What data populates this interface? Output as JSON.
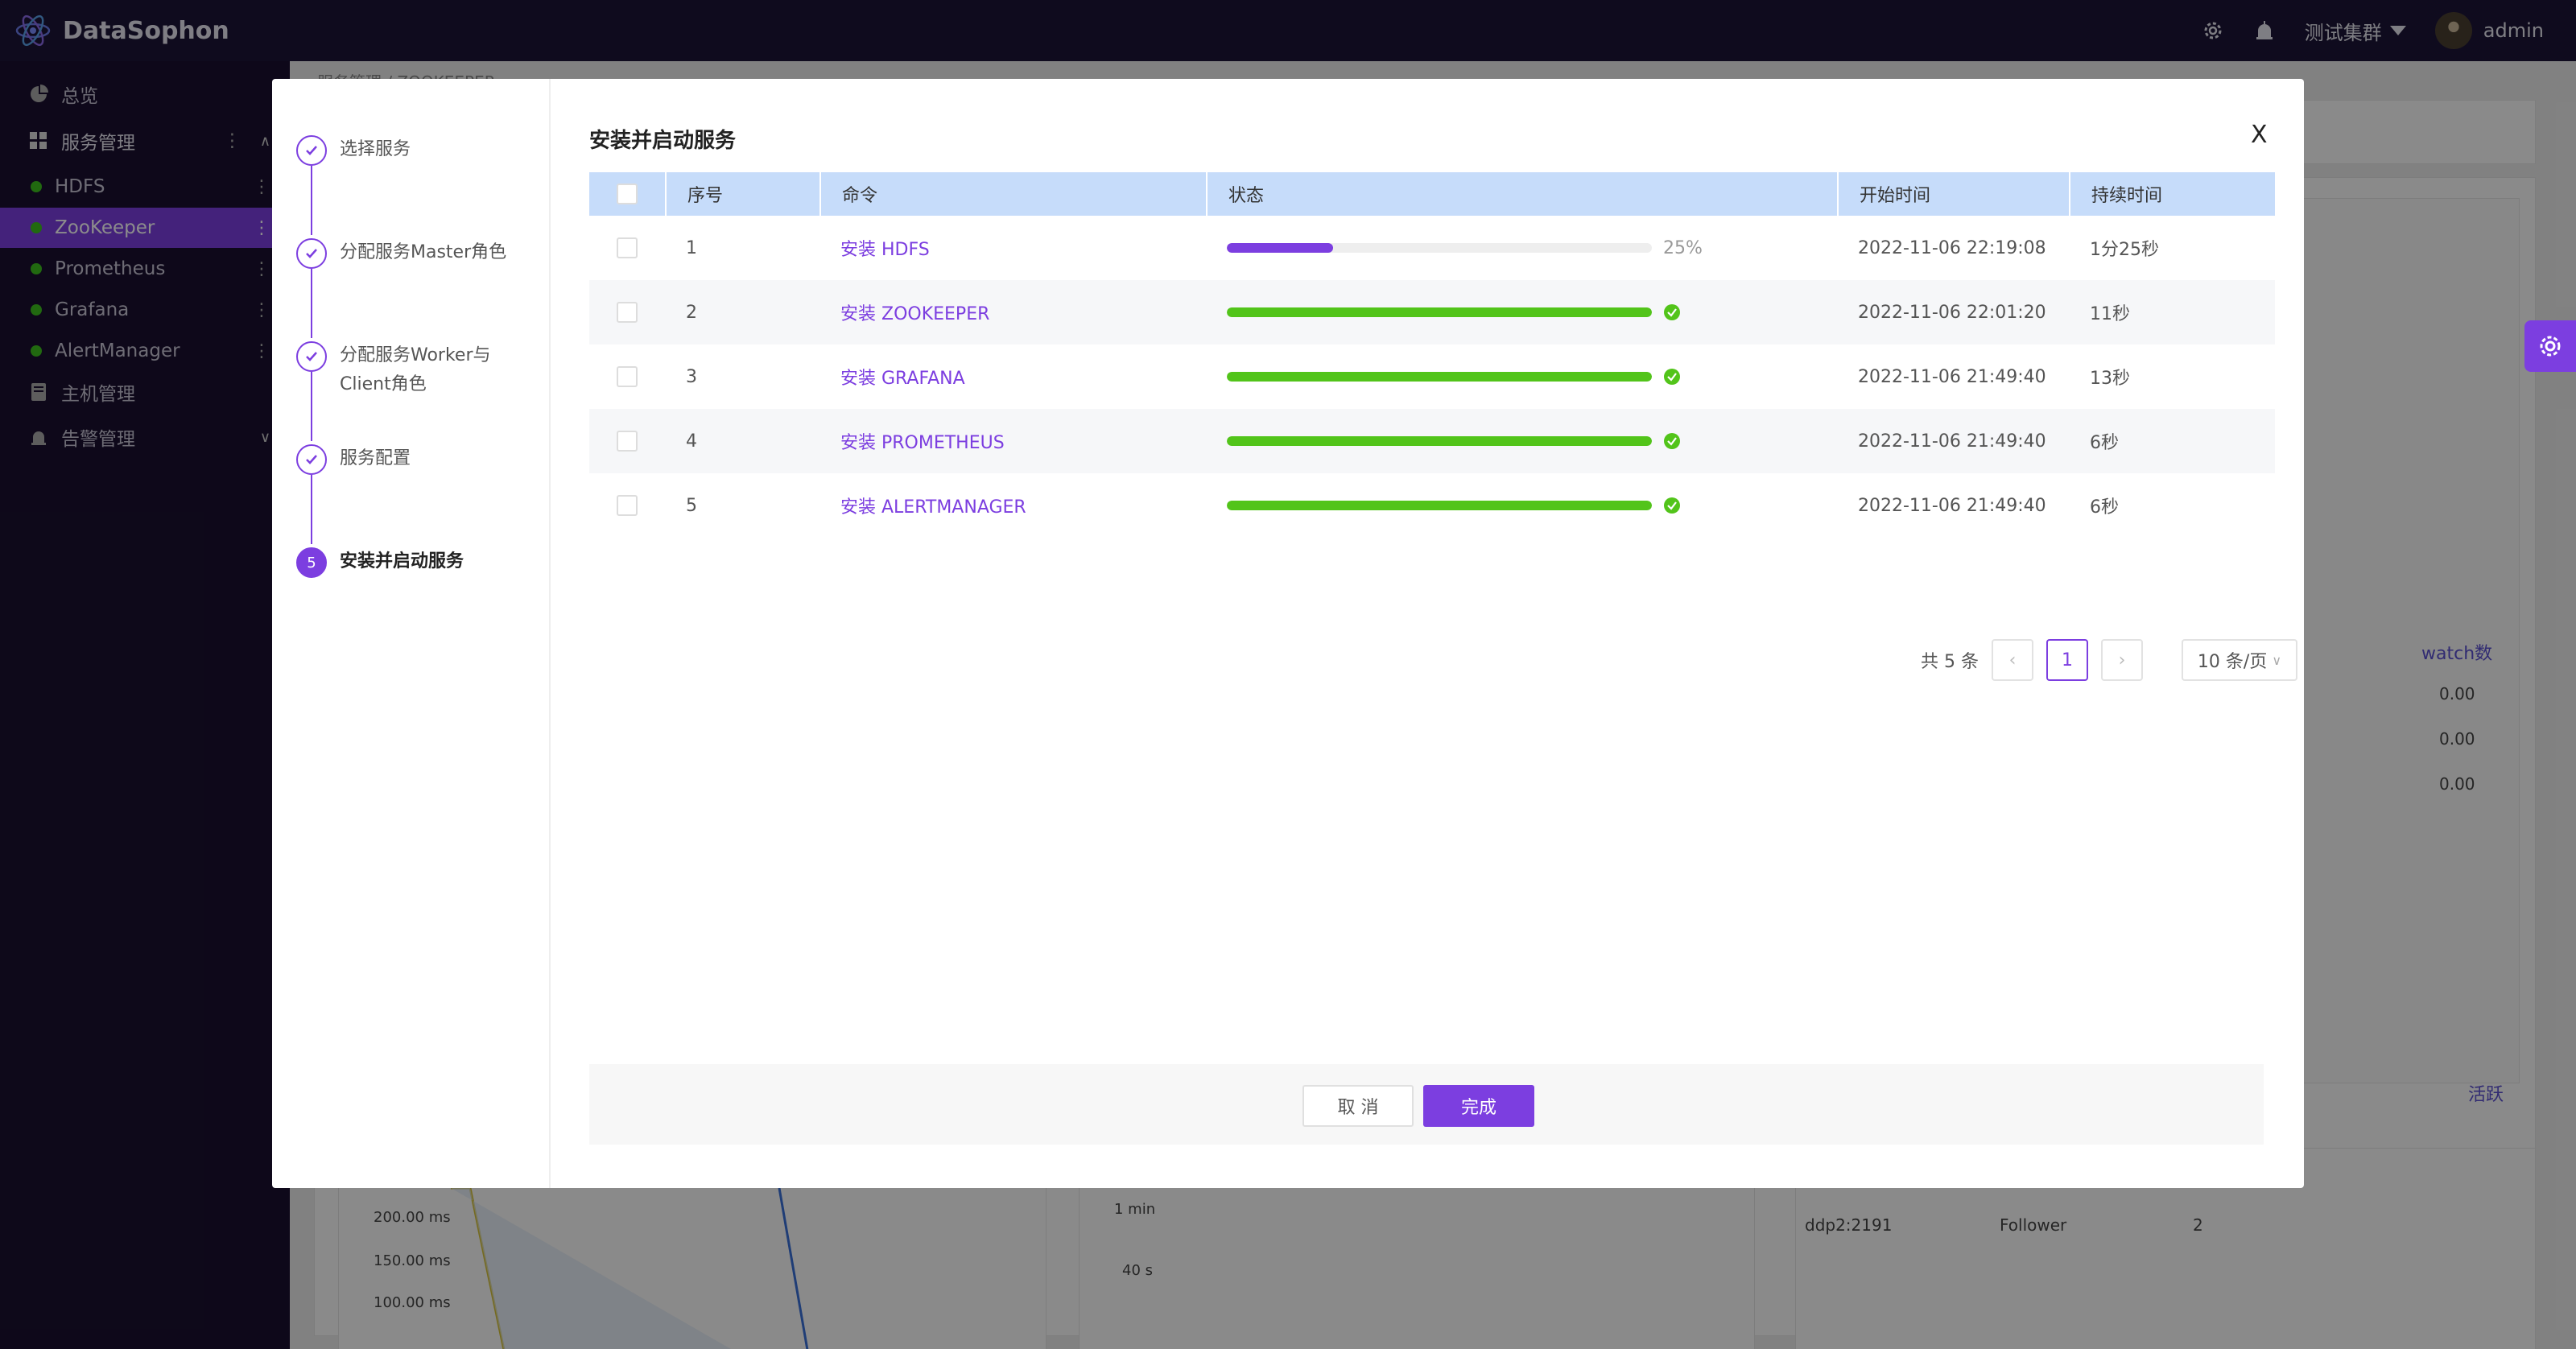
{
  "app": {
    "logo_text": "DataSophon",
    "cluster_name": "测试集群",
    "user_name": "admin"
  },
  "sidebar": {
    "items": [
      {
        "label": "总览"
      },
      {
        "label": "服务管理"
      },
      {
        "label": "HDFS"
      },
      {
        "label": "ZooKeeper"
      },
      {
        "label": "Prometheus"
      },
      {
        "label": "Grafana"
      },
      {
        "label": "AlertManager"
      },
      {
        "label": "主机管理"
      },
      {
        "label": "告警管理"
      }
    ]
  },
  "background": {
    "breadcrumb": "服务管理 / ZOOKEEPER",
    "watch_label": "watch数",
    "watch_values": [
      "0.00",
      "0.00",
      "0.00"
    ],
    "active_label": "活跃",
    "chart_ticks_left": [
      "200.00 ms",
      "150.00 ms",
      "100.00 ms"
    ],
    "chart_ticks_mid": [
      "1 min",
      "40 s"
    ],
    "host_row": {
      "host": "ddp2:2191",
      "role": "Follower",
      "value": "2"
    }
  },
  "wizard": {
    "steps": [
      {
        "label": "选择服务"
      },
      {
        "label": "分配服务Master角色"
      },
      {
        "label": "分配服务Worker与Client角色"
      },
      {
        "label": "服务配置"
      },
      {
        "label": "安装并启动服务",
        "number": "5"
      }
    ]
  },
  "modal": {
    "title": "安装并启动服务",
    "close_label": "X"
  },
  "table": {
    "columns": {
      "index": "序号",
      "command": "命令",
      "status": "状态",
      "start_time": "开始时间",
      "duration": "持续时间"
    },
    "rows": [
      {
        "index": "1",
        "command": "安装 HDFS",
        "progress": 25,
        "progress_label": "25%",
        "start_time": "2022-11-06 22:19:08",
        "duration": "1分25秒"
      },
      {
        "index": "2",
        "command": "安装 ZOOKEEPER",
        "progress": 100,
        "start_time": "2022-11-06 22:01:20",
        "duration": "11秒"
      },
      {
        "index": "3",
        "command": "安装 GRAFANA",
        "progress": 100,
        "start_time": "2022-11-06 21:49:40",
        "duration": "13秒"
      },
      {
        "index": "4",
        "command": "安装 PROMETHEUS",
        "progress": 100,
        "start_time": "2022-11-06 21:49:40",
        "duration": "6秒"
      },
      {
        "index": "5",
        "command": "安装 ALERTMANAGER",
        "progress": 100,
        "start_time": "2022-11-06 21:49:40",
        "duration": "6秒"
      }
    ]
  },
  "pagination": {
    "total": "共 5 条",
    "current_page": "1",
    "page_size": "10 条/页"
  },
  "footer": {
    "cancel_label": "取 消",
    "done_label": "完成"
  },
  "colors": {
    "accent": "#7c3ee0",
    "success": "#52c41a",
    "header_bg": "#c6dcfa"
  }
}
